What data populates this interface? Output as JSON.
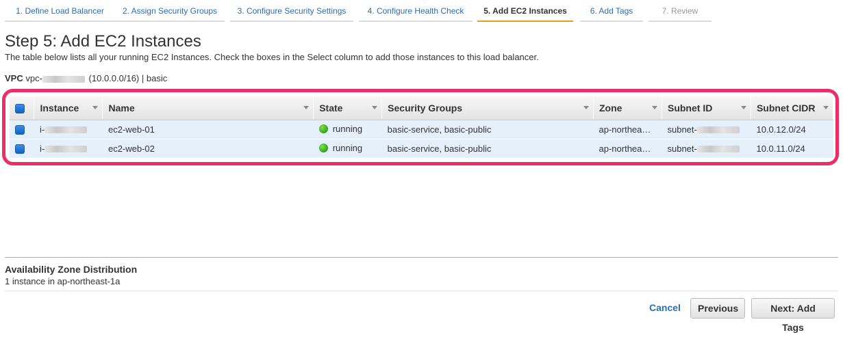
{
  "wizard": {
    "tabs": [
      {
        "label": "1. Define Load Balancer"
      },
      {
        "label": "2. Assign Security Groups"
      },
      {
        "label": "3. Configure Security Settings"
      },
      {
        "label": "4. Configure Health Check"
      },
      {
        "label": "5. Add EC2 Instances"
      },
      {
        "label": "6. Add Tags"
      },
      {
        "label": "7. Review"
      }
    ],
    "active_tab": "5. Add EC2 Instances"
  },
  "page": {
    "title": "Step 5: Add EC2 Instances",
    "description": "The table below lists all your running EC2 Instances. Check the boxes in the Select column to add those instances to this load balancer."
  },
  "vpc": {
    "label": "VPC",
    "id_prefix": "vpc-",
    "cidr": "(10.0.0.0/16) | basic"
  },
  "table": {
    "columns": [
      "Instance",
      "Name",
      "State",
      "Security Groups",
      "Zone",
      "Subnet ID",
      "Subnet CIDR"
    ],
    "rows": [
      {
        "instance_prefix": "i-",
        "name": "ec2-web-01",
        "state": "running",
        "security_groups": "basic-service, basic-public",
        "zone": "ap-northea…",
        "subnet_prefix": "subnet-",
        "subnet_cidr": "10.0.12.0/24"
      },
      {
        "instance_prefix": "i-",
        "name": "ec2-web-02",
        "state": "running",
        "security_groups": "basic-service, basic-public",
        "zone": "ap-northea…",
        "subnet_prefix": "subnet-",
        "subnet_cidr": "10.0.11.0/24"
      }
    ]
  },
  "az_distribution": {
    "title": "Availability Zone Distribution",
    "text": "1 instance in ap-northeast-1a"
  },
  "footer": {
    "cancel_label": "Cancel",
    "previous_label": "Previous",
    "next_label": "Next: Add Tags"
  },
  "colors": {
    "highlight": "#ec2e66",
    "active_tab_underline": "#ec9a1e",
    "link": "#2a6db5",
    "row_selected": "#e5f0fb",
    "state_running": "#2ea11b"
  }
}
